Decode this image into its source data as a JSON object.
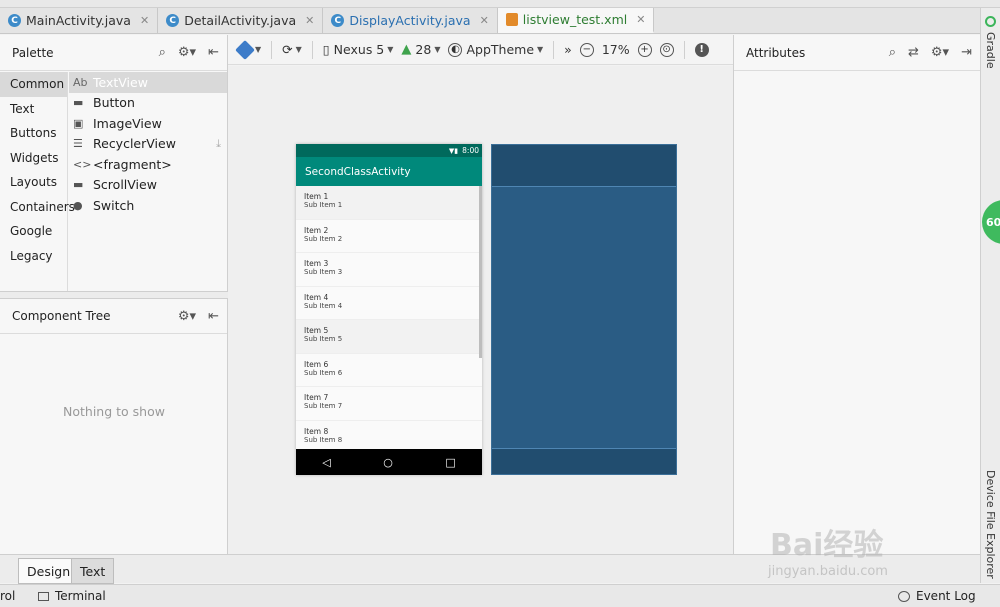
{
  "tabs": [
    {
      "label": "MainActivity.java",
      "icon": "java-class-icon",
      "active": false
    },
    {
      "label": "DetailActivity.java",
      "icon": "java-class-icon",
      "active": false
    },
    {
      "label": "DisplayActivity.java",
      "icon": "java-class-icon",
      "active": false
    },
    {
      "label": "listview_test.xml",
      "icon": "xml-file-icon",
      "active": true
    }
  ],
  "palette": {
    "title": "Palette",
    "categories": [
      "Common",
      "Text",
      "Buttons",
      "Widgets",
      "Layouts",
      "Containers",
      "Google",
      "Legacy"
    ],
    "selected_category": "Common",
    "items": [
      {
        "glyph": "Ab",
        "label": "TextView"
      },
      {
        "glyph": "▬",
        "label": "Button"
      },
      {
        "glyph": "▣",
        "label": "ImageView"
      },
      {
        "glyph": "☰",
        "label": "RecyclerView"
      },
      {
        "glyph": "<>",
        "label": "<fragment>"
      },
      {
        "glyph": "▬",
        "label": "ScrollView"
      },
      {
        "glyph": "●",
        "label": "Switch"
      }
    ]
  },
  "component_tree": {
    "title": "Component Tree",
    "empty_text": "Nothing to show"
  },
  "editor_toolbar": {
    "device": "Nexus 5",
    "api": "28",
    "theme": "AppTheme",
    "zoom": "17%"
  },
  "phone": {
    "time": "8:00",
    "app_title": "SecondClassActivity",
    "rows": [
      {
        "t1": "Item 1",
        "t2": "Sub Item 1"
      },
      {
        "t1": "Item 2",
        "t2": "Sub Item 2"
      },
      {
        "t1": "Item 3",
        "t2": "Sub Item 3"
      },
      {
        "t1": "Item 4",
        "t2": "Sub Item 4"
      },
      {
        "t1": "Item 5",
        "t2": "Sub Item 5"
      },
      {
        "t1": "Item 6",
        "t2": "Sub Item 6"
      },
      {
        "t1": "Item 7",
        "t2": "Sub Item 7"
      },
      {
        "t1": "Item 8",
        "t2": "Sub Item 8"
      }
    ],
    "nav": {
      "back": "◁",
      "home": "○",
      "recent": "□"
    }
  },
  "attributes": {
    "title": "Attributes"
  },
  "right_strip": {
    "gradle": "Gradle",
    "device_file_explorer": "Device File Explorer",
    "badge": "60"
  },
  "bottom_tabs": {
    "design": "Design",
    "text": "Text"
  },
  "status": {
    "left": "rol",
    "terminal": "Terminal",
    "event_log": "Event Log"
  },
  "watermark": {
    "brand": "Bai经验",
    "url": "jingyan.baidu.com"
  }
}
